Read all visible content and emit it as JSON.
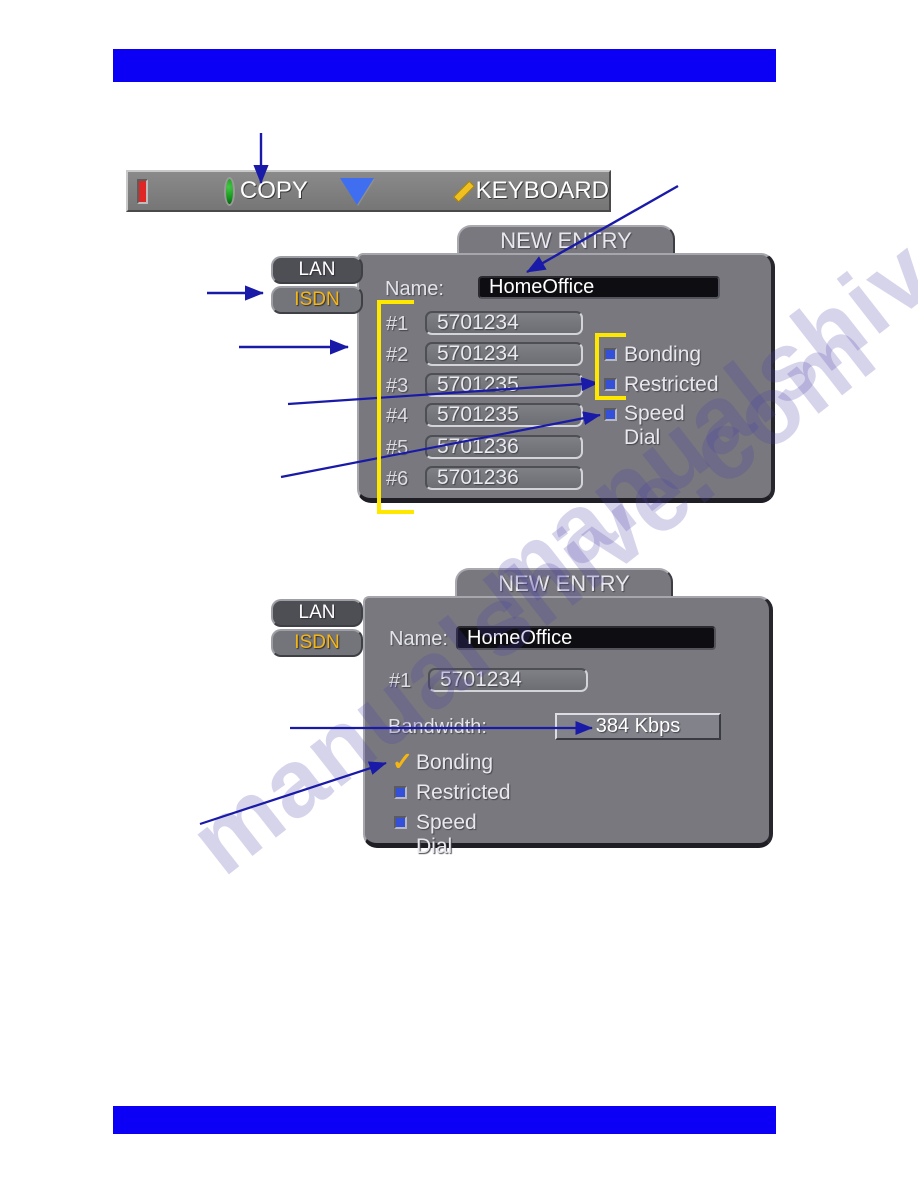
{
  "page": {
    "rule_color": "#0b00f5",
    "watermark_text": "manualshive.com"
  },
  "toolbar": {
    "stop_icon": "red-square-icon",
    "copy_icon": "green-circle-icon",
    "copy_label": "COPY",
    "down_icon": "blue-triangle-icon",
    "keyboard_icon": "yellow-diamond-icon",
    "keyboard_label": "KEYBOARD"
  },
  "dialog1": {
    "title": "NEW ENTRY",
    "tabs": [
      {
        "label": "LAN",
        "active": false
      },
      {
        "label": "ISDN",
        "active": true
      }
    ],
    "name_label": "Name:",
    "name_value": "HomeOffice",
    "numbers": [
      {
        "label": "#1",
        "value": "5701234"
      },
      {
        "label": "#2",
        "value": "5701234"
      },
      {
        "label": "#3",
        "value": "5701235"
      },
      {
        "label": "#4",
        "value": "5701235"
      },
      {
        "label": "#5",
        "value": "5701236"
      },
      {
        "label": "#6",
        "value": "5701236"
      }
    ],
    "options": [
      {
        "label": "Bonding",
        "checked": false
      },
      {
        "label": "Restricted",
        "checked": false
      },
      {
        "label": "Speed Dial",
        "checked": false
      }
    ]
  },
  "dialog2": {
    "title": "NEW ENTRY",
    "tabs": [
      {
        "label": "LAN",
        "active": false
      },
      {
        "label": "ISDN",
        "active": true
      }
    ],
    "name_label": "Name:",
    "name_value": "HomeOffice",
    "number_label": "#1",
    "number_value": "5701234",
    "bandwidth_label": "Bandwidth:",
    "bandwidth_value": "384  Kbps",
    "options": [
      {
        "label": "Bonding",
        "checked": true
      },
      {
        "label": "Restricted",
        "checked": false
      },
      {
        "label": "Speed Dial",
        "checked": false
      }
    ]
  },
  "annotations": {
    "bracket_color": "#ffe800",
    "arrow_color": "#1a1aa8"
  }
}
